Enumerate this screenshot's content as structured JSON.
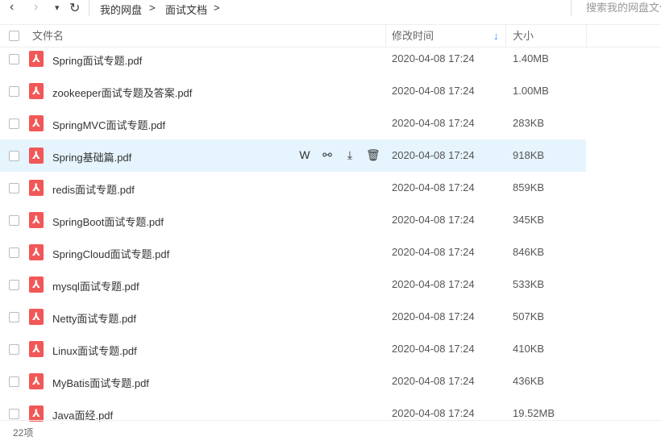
{
  "nav": {
    "back": "‹",
    "forward": "›",
    "dropdown": "▾",
    "refresh": "↻"
  },
  "breadcrumb": [
    {
      "label": "我的网盘"
    },
    {
      "label": "面试文档"
    }
  ],
  "breadcrumb_sep": ">",
  "search": {
    "placeholder": "搜索我的网盘文件"
  },
  "header": {
    "name": "文件名",
    "modified": "修改时间",
    "size": "大小",
    "sort_icon": "↓"
  },
  "files": [
    {
      "name": "Spring面试专题.pdf",
      "date": "2020-04-08 17:24",
      "size": "1.40MB"
    },
    {
      "name": "zookeeper面试专题及答案.pdf",
      "date": "2020-04-08 17:24",
      "size": "1.00MB"
    },
    {
      "name": "SpringMVC面试专题.pdf",
      "date": "2020-04-08 17:24",
      "size": "283KB"
    },
    {
      "name": "Spring基础篇.pdf",
      "date": "2020-04-08 17:24",
      "size": "918KB"
    },
    {
      "name": "redis面试专题.pdf",
      "date": "2020-04-08 17:24",
      "size": "859KB"
    },
    {
      "name": "SpringBoot面试专题.pdf",
      "date": "2020-04-08 17:24",
      "size": "345KB"
    },
    {
      "name": "SpringCloud面试专题.pdf",
      "date": "2020-04-08 17:24",
      "size": "846KB"
    },
    {
      "name": "mysql面试专题.pdf",
      "date": "2020-04-08 17:24",
      "size": "533KB"
    },
    {
      "name": "Netty面试专题.pdf",
      "date": "2020-04-08 17:24",
      "size": "507KB"
    },
    {
      "name": "Linux面试专题.pdf",
      "date": "2020-04-08 17:24",
      "size": "410KB"
    },
    {
      "name": "MyBatis面试专题.pdf",
      "date": "2020-04-08 17:24",
      "size": "436KB"
    },
    {
      "name": "Java面经.pdf",
      "date": "2020-04-08 17:24",
      "size": "19.52MB"
    }
  ],
  "hover_actions": [
    "W",
    "⚯",
    "⤓",
    "🗑"
  ],
  "footer": {
    "count": "22项"
  },
  "colors": {
    "accent": "#1a8cff",
    "pdf": "#f25757",
    "highlight": "#e5f4fd"
  }
}
